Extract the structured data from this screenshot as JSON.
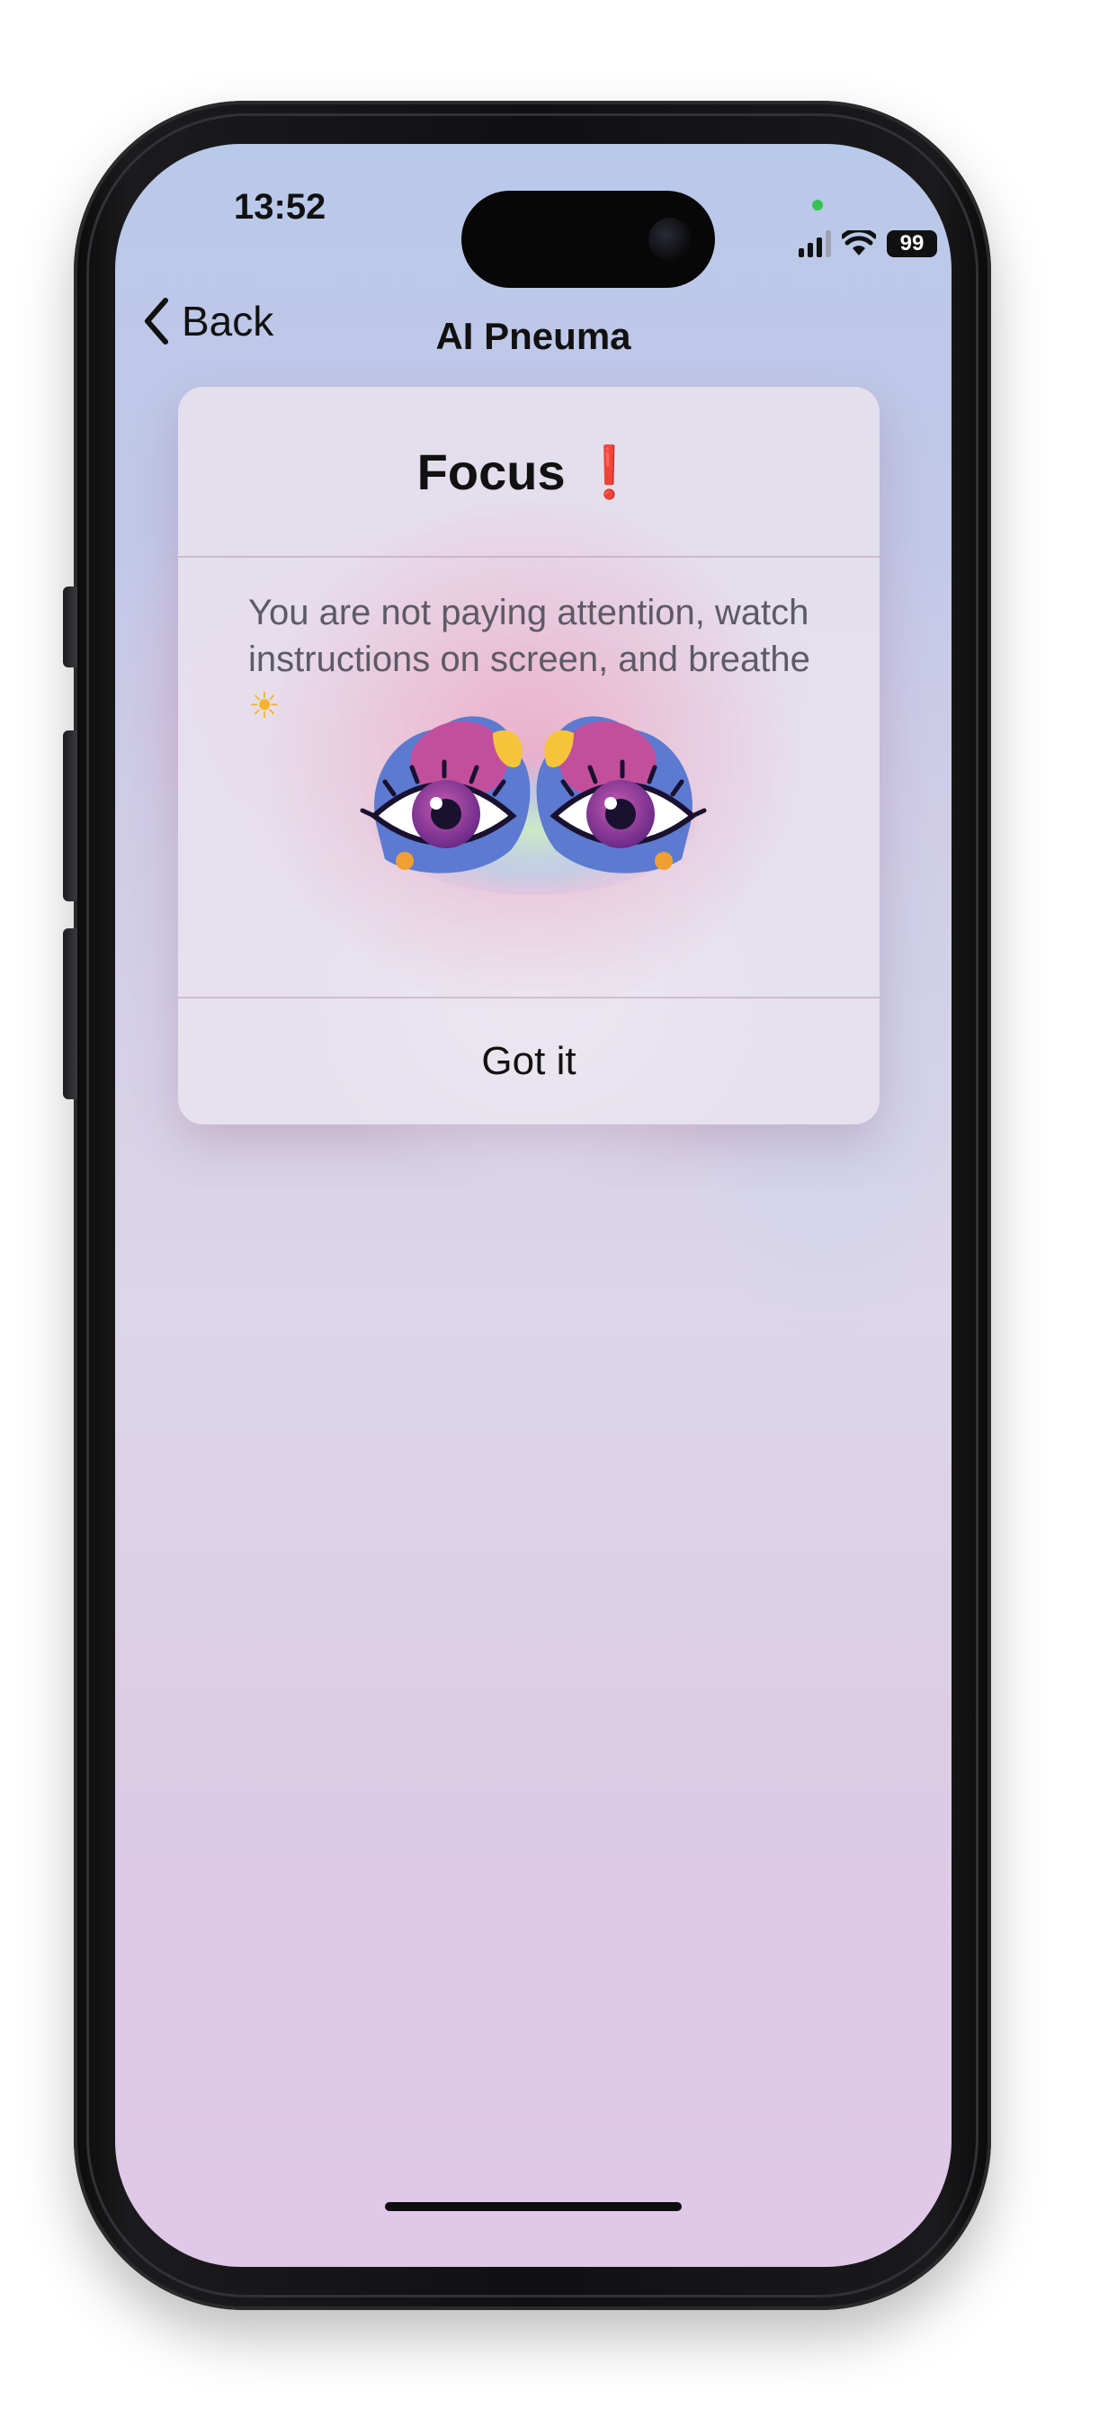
{
  "status_bar": {
    "time": "13:52",
    "battery": "99",
    "icons": [
      "signal-icon",
      "wifi-icon",
      "battery-icon"
    ]
  },
  "nav": {
    "back_label": "Back",
    "title": "AI Pneuma"
  },
  "alert": {
    "title": "Focus",
    "title_icon": "❗",
    "message": "You are not paying attention, watch instructions on screen, and breathe",
    "message_icon": "☀",
    "illustration": "eyes-illustration",
    "button_label": "Got it"
  },
  "colors": {
    "accent_red": "#e0202a",
    "background_top": "#b9c9e9",
    "background_bottom": "#e0c8e8"
  }
}
